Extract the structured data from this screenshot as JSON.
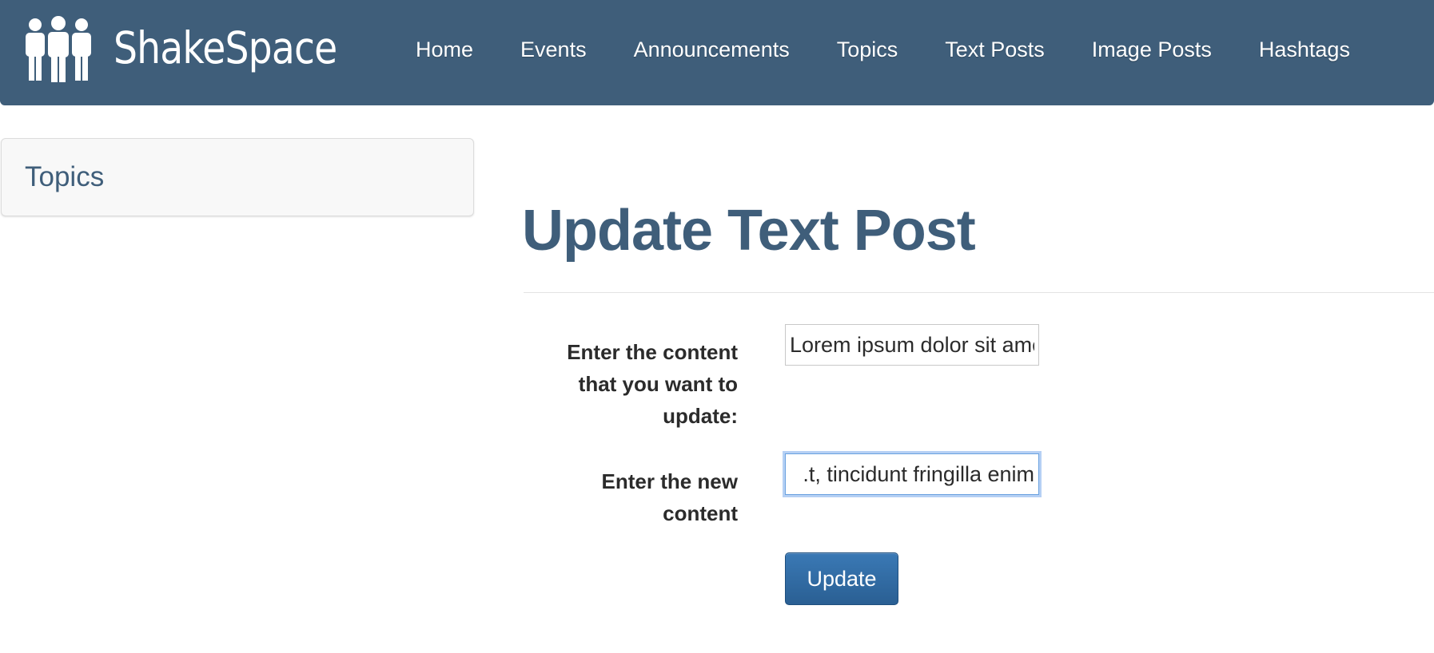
{
  "colors": {
    "navbar_bg": "#3f5e7a",
    "heading": "#3f5e7a",
    "button_bg": "#2f6ca4",
    "focus_ring": "#6aa1e0"
  },
  "navbar": {
    "brand_icon": "people-group-icon",
    "brand_name": "ShakeSpace",
    "links": [
      {
        "label": "Home"
      },
      {
        "label": "Events"
      },
      {
        "label": "Announcements"
      },
      {
        "label": "Topics"
      },
      {
        "label": "Text Posts"
      },
      {
        "label": "Image Posts"
      },
      {
        "label": "Hashtags"
      }
    ]
  },
  "sidebar": {
    "title": "Topics"
  },
  "main": {
    "title": "Update Text Post",
    "form": {
      "current_content_label": "Enter the content that you want to update:",
      "current_content_value": "Lorem ipsum dolor sit amet",
      "new_content_label": "Enter the new content",
      "new_content_value": "t, tincidunt fringilla enim.",
      "submit_label": "Update"
    }
  }
}
